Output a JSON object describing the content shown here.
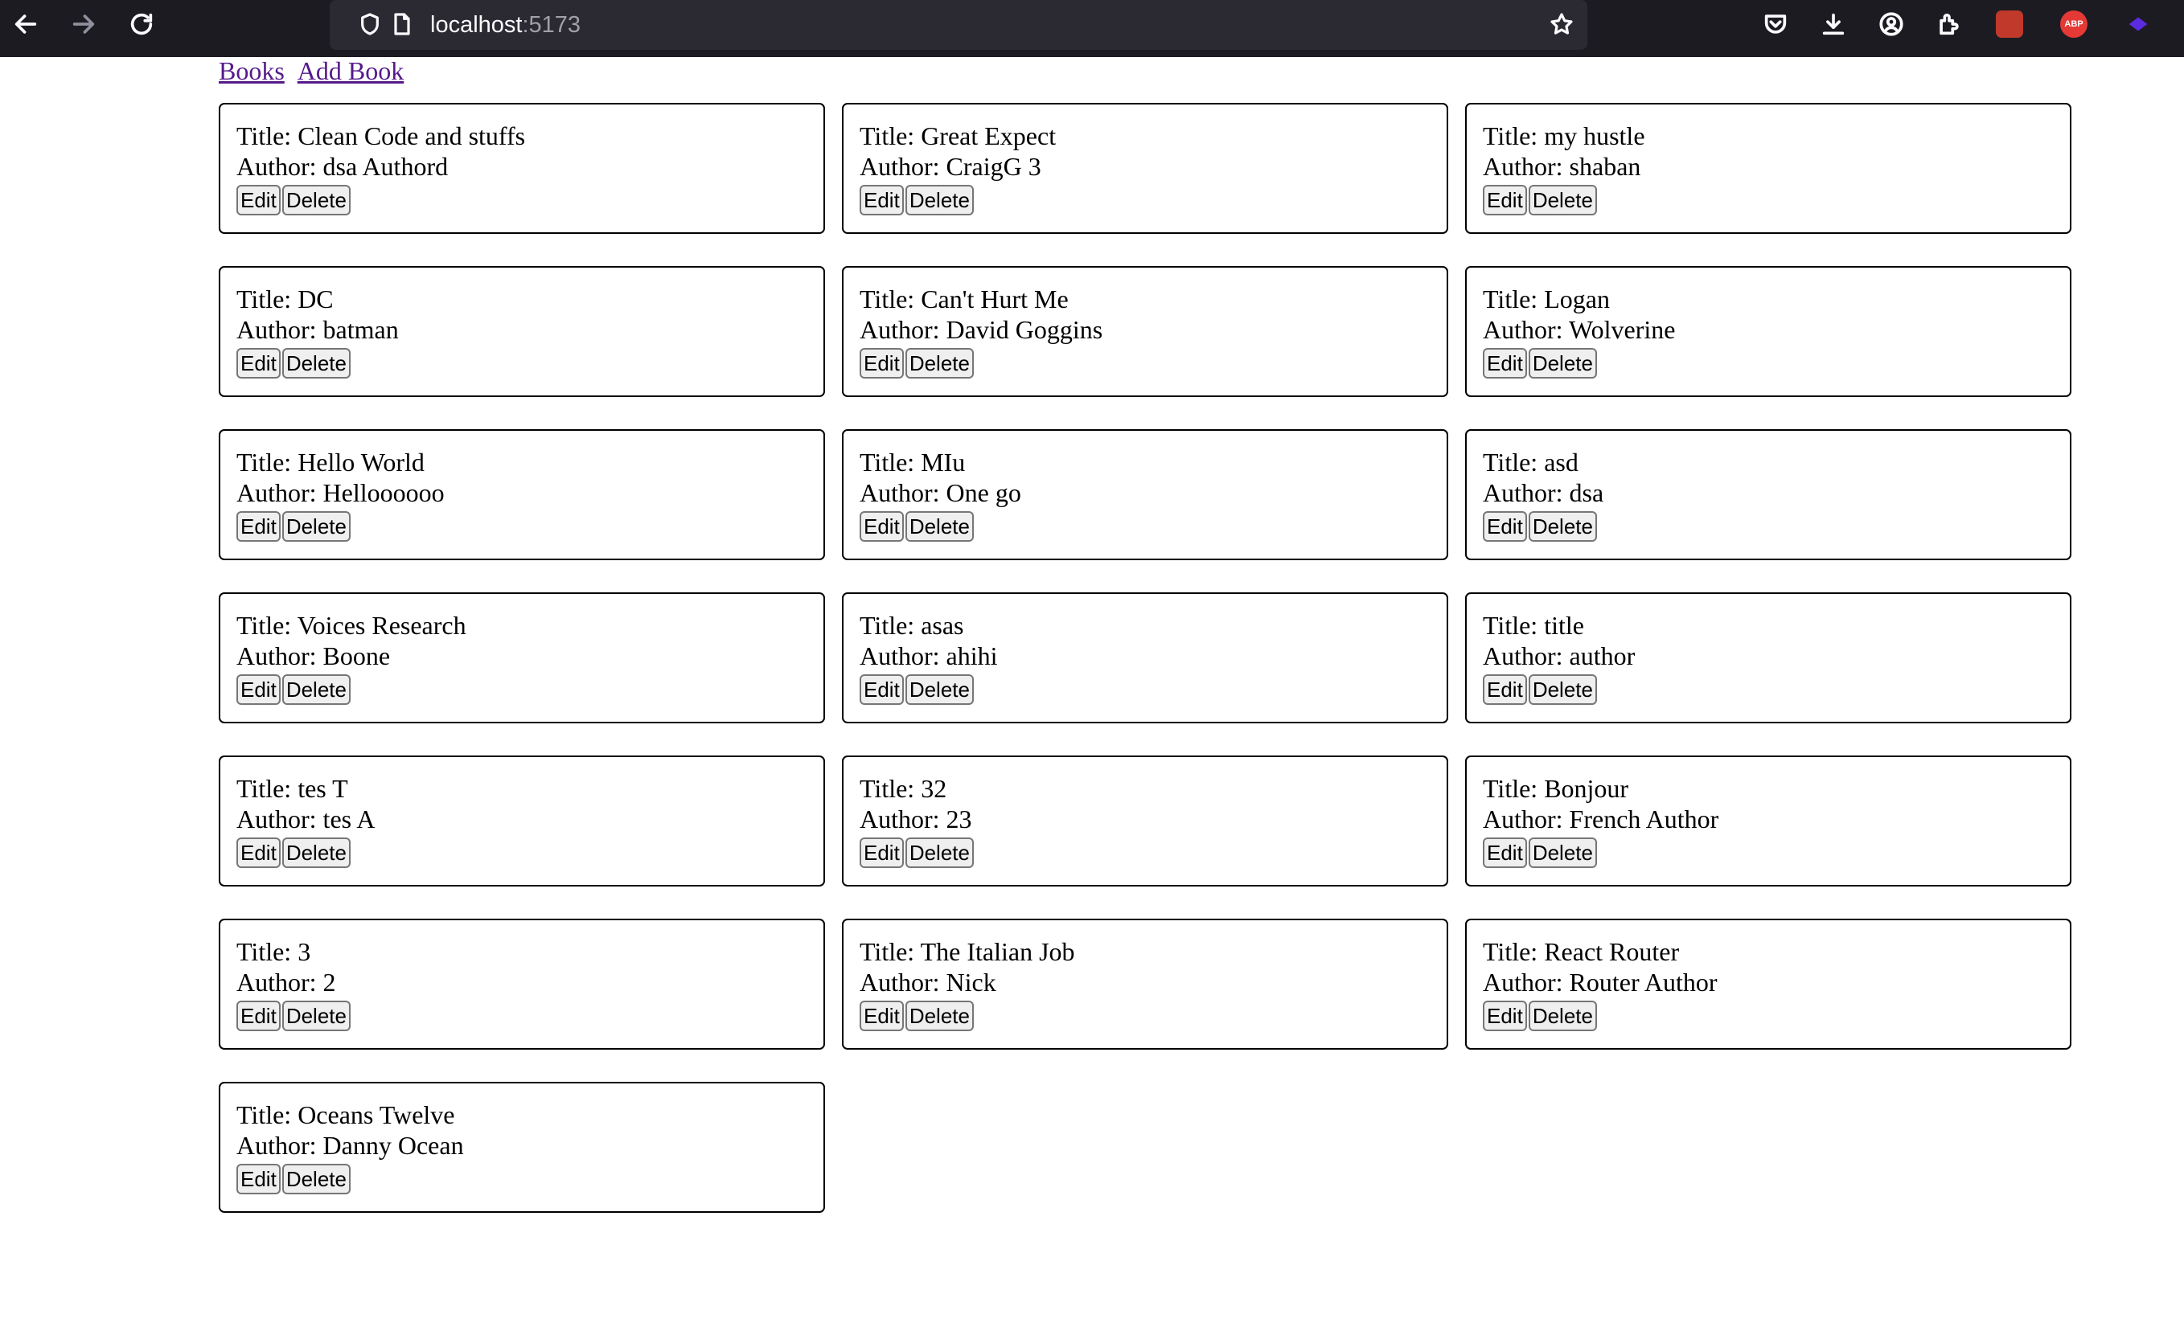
{
  "browser": {
    "url_host": "localhost",
    "url_port": ":5173"
  },
  "nav": {
    "books_label": "Books",
    "add_book_label": "Add Book"
  },
  "card_labels": {
    "title_prefix": "Title:",
    "author_prefix": "Author:",
    "edit_label": "Edit",
    "delete_label": "Delete"
  },
  "books": [
    {
      "title": "Clean Code and stuffs",
      "author": "dsa Authord"
    },
    {
      "title": "Great Expect",
      "author": "CraigG 3"
    },
    {
      "title": "my hustle",
      "author": "shaban"
    },
    {
      "title": "DC",
      "author": "batman"
    },
    {
      "title": "Can't Hurt Me",
      "author": "David Goggins"
    },
    {
      "title": "Logan",
      "author": "Wolverine"
    },
    {
      "title": "Hello World",
      "author": "Helloooooo"
    },
    {
      "title": "MIu",
      "author": "One go"
    },
    {
      "title": "asd",
      "author": "dsa"
    },
    {
      "title": "Voices Research",
      "author": "Boone"
    },
    {
      "title": "asas",
      "author": "ahihi"
    },
    {
      "title": "title",
      "author": "author"
    },
    {
      "title": "tes T",
      "author": "tes A"
    },
    {
      "title": "32",
      "author": "23"
    },
    {
      "title": "Bonjour",
      "author": "French Author"
    },
    {
      "title": "3",
      "author": "2"
    },
    {
      "title": "The Italian Job",
      "author": "Nick"
    },
    {
      "title": "React Router",
      "author": "Router Author"
    },
    {
      "title": "Oceans Twelve",
      "author": "Danny Ocean"
    }
  ],
  "icons": {
    "back": "arrow-left-icon",
    "forward": "arrow-right-icon",
    "reload": "reload-icon",
    "shield": "shield-icon",
    "page": "page-icon",
    "bookmark": "star-icon",
    "pocket": "pocket-icon",
    "downloads": "download-icon",
    "account": "account-icon",
    "extensions": "extensions-icon"
  },
  "colors": {
    "toolbar_bg": "#1c1b22",
    "urlbar_bg": "#2b2a33",
    "link": "#551a8b",
    "abp_red": "#e53936"
  }
}
